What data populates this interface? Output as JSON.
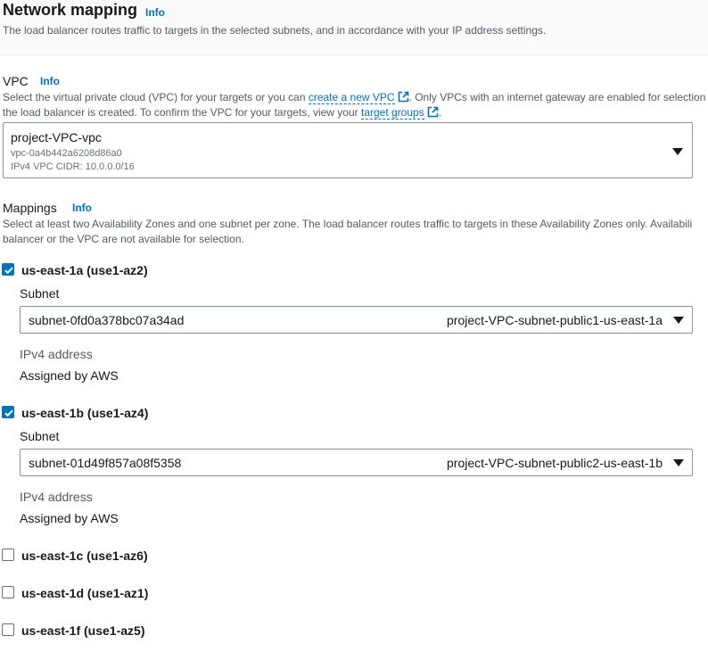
{
  "section": {
    "title": "Network mapping",
    "info": "Info",
    "description": "The load balancer routes traffic to targets in the selected subnets, and in accordance with your IP address settings."
  },
  "vpc": {
    "label": "VPC",
    "info": "Info",
    "desc_part1": "Select the virtual private cloud (VPC) for your targets or you can ",
    "create_link": "create a new VPC",
    "desc_part2": ". Only VPCs with an internet gateway are enabled for selection",
    "desc_line2": "the load balancer is created. To confirm the VPC for your targets, view your ",
    "target_groups_link": "target groups",
    "desc_end": ".",
    "selected": {
      "name": "project-VPC-vpc",
      "id": "vpc-0a4b442a6208d86a0",
      "cidr": "IPv4 VPC CIDR: 10.0.0.0/16"
    }
  },
  "mappings": {
    "label": "Mappings",
    "info": "Info",
    "desc_line1": "Select at least two Availability Zones and one subnet per zone. The load balancer routes traffic to targets in these Availability Zones only. Availabili",
    "desc_line2": "balancer or the VPC are not available for selection.",
    "zones": [
      {
        "name": "us-east-1a (use1-az2)",
        "checked": true,
        "subnet_label": "Subnet",
        "subnet_id": "subnet-0fd0a378bc07a34ad",
        "subnet_name": "project-VPC-subnet-public1-us-east-1a",
        "ipv4_label": "IPv4 address",
        "ipv4_value": "Assigned by AWS"
      },
      {
        "name": "us-east-1b (use1-az4)",
        "checked": true,
        "subnet_label": "Subnet",
        "subnet_id": "subnet-01d49f857a08f5358",
        "subnet_name": "project-VPC-subnet-public2-us-east-1b",
        "ipv4_label": "IPv4 address",
        "ipv4_value": "Assigned by AWS"
      },
      {
        "name": "us-east-1c (use1-az6)",
        "checked": false
      },
      {
        "name": "us-east-1d (use1-az1)",
        "checked": false
      },
      {
        "name": "us-east-1f (use1-az5)",
        "checked": false
      }
    ]
  },
  "colors": {
    "link": "#0073bb",
    "checkbox_checked": "#0073bb",
    "text": "#16191f",
    "muted": "#545b64"
  }
}
